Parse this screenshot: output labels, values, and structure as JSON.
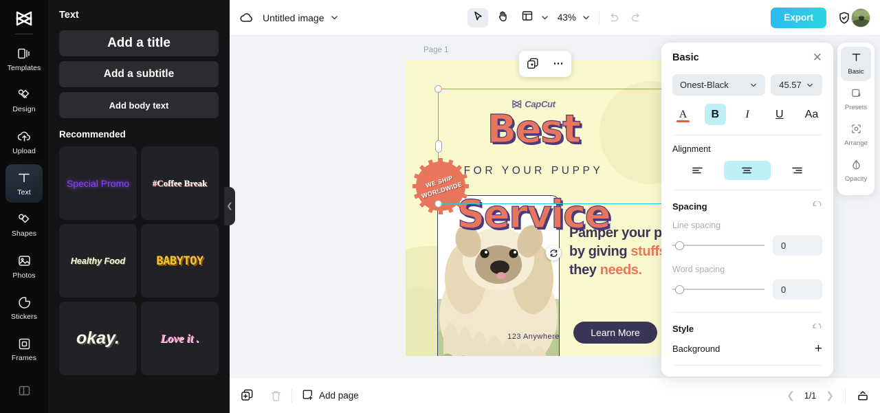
{
  "app": {
    "logo": "capcut-logo"
  },
  "left_rail": {
    "items": [
      {
        "label": "Templates",
        "icon": "templates-icon",
        "active": false
      },
      {
        "label": "Design",
        "icon": "design-icon",
        "active": false
      },
      {
        "label": "Upload",
        "icon": "upload-icon",
        "active": false
      },
      {
        "label": "Text",
        "icon": "text-icon",
        "active": true
      },
      {
        "label": "Shapes",
        "icon": "shapes-icon",
        "active": false
      },
      {
        "label": "Photos",
        "icon": "photos-icon",
        "active": false
      },
      {
        "label": "Stickers",
        "icon": "stickers-icon",
        "active": false
      },
      {
        "label": "Frames",
        "icon": "frames-icon",
        "active": false
      }
    ]
  },
  "left_panel": {
    "title": "Text",
    "buttons": [
      {
        "label": "Add a title"
      },
      {
        "label": "Add a subtitle"
      },
      {
        "label": "Add body text"
      }
    ],
    "recommended_title": "Recommended",
    "recommended": [
      {
        "label": "Special Promo"
      },
      {
        "label": "#Coffee Break"
      },
      {
        "label": "Healthy Food"
      },
      {
        "label": "BABYTOY"
      },
      {
        "label": "okay."
      },
      {
        "label": "Love it ."
      }
    ]
  },
  "topbar": {
    "cloud_icon": "cloud-sync-icon",
    "doc_title": "Untitled image",
    "title_caret": "chevron-down-icon",
    "tools": [
      {
        "name": "select-tool",
        "icon": "cursor-arrow-icon",
        "selected": true
      },
      {
        "name": "hand-tool",
        "icon": "hand-icon",
        "selected": false
      },
      {
        "name": "layout-tool",
        "icon": "layout-icon",
        "selected": false
      }
    ],
    "zoom": "43%",
    "undo_icon": "undo-icon",
    "redo_icon": "redo-icon",
    "export_label": "Export",
    "shield_icon": "shield-check-icon",
    "avatar": "user-avatar"
  },
  "canvas": {
    "page_label": "Page 1",
    "watermark": "CapCut",
    "float_toolbar": {
      "duplicate_icon": "duplicate-icon",
      "more_icon": "more-options-icon"
    },
    "rotate_icon": "rotate-handle-icon",
    "design": {
      "headline_top": "Best",
      "subline": "FOR YOUR PUPPY",
      "headline_bottom": "Service",
      "badge_line1": "WE SHIP",
      "badge_line2": "WORLDWIDE",
      "body_pre": "Pamper your pup by giving ",
      "body_em": "stuffs",
      "body_mid": " they ",
      "body_em2": "needs.",
      "cta_label": "Learn More",
      "footer": "123 Anywhere",
      "colors": {
        "background": "#faf8cd",
        "accent": "#e8765c",
        "ink": "#3b3557",
        "shadow": "#4b3a7e",
        "selection": "#14d0e5"
      }
    }
  },
  "properties": {
    "title": "Basic",
    "close_icon": "close-icon",
    "font_family": "Onest-Black",
    "font_size": "45.57",
    "text_style": [
      {
        "name": "text-color",
        "glyph": "A",
        "active": false
      },
      {
        "name": "bold",
        "glyph": "B",
        "active": true
      },
      {
        "name": "italic",
        "glyph": "I",
        "active": false
      },
      {
        "name": "underline",
        "glyph": "U",
        "active": false
      },
      {
        "name": "letter-case",
        "glyph": "Aa",
        "active": false
      }
    ],
    "alignment_label": "Alignment",
    "alignment": [
      {
        "name": "align-left",
        "active": false
      },
      {
        "name": "align-center",
        "active": true
      },
      {
        "name": "align-right",
        "active": false
      }
    ],
    "spacing_label": "Spacing",
    "line_spacing_label": "Line spacing",
    "line_spacing_value": "0",
    "word_spacing_label": "Word spacing",
    "word_spacing_value": "0",
    "style_label": "Style",
    "background_label": "Background",
    "reset_icon": "reset-icon",
    "add_icon": "plus-icon"
  },
  "right_rail": {
    "items": [
      {
        "label": "Basic",
        "icon": "text-basic-icon",
        "active": true
      },
      {
        "label": "Presets",
        "icon": "presets-icon",
        "active": false
      },
      {
        "label": "Arrange",
        "icon": "arrange-icon",
        "active": false
      },
      {
        "label": "Opacity",
        "icon": "opacity-icon",
        "active": false
      }
    ]
  },
  "bottombar": {
    "duplicate_icon": "duplicate-page-icon",
    "delete_icon": "trash-icon",
    "add_page_label": "Add page",
    "add_page_icon": "add-page-icon",
    "prev_icon": "chevron-left-icon",
    "page_count": "1/1",
    "next_icon": "chevron-right-icon",
    "grid_icon": "page-grid-icon"
  }
}
